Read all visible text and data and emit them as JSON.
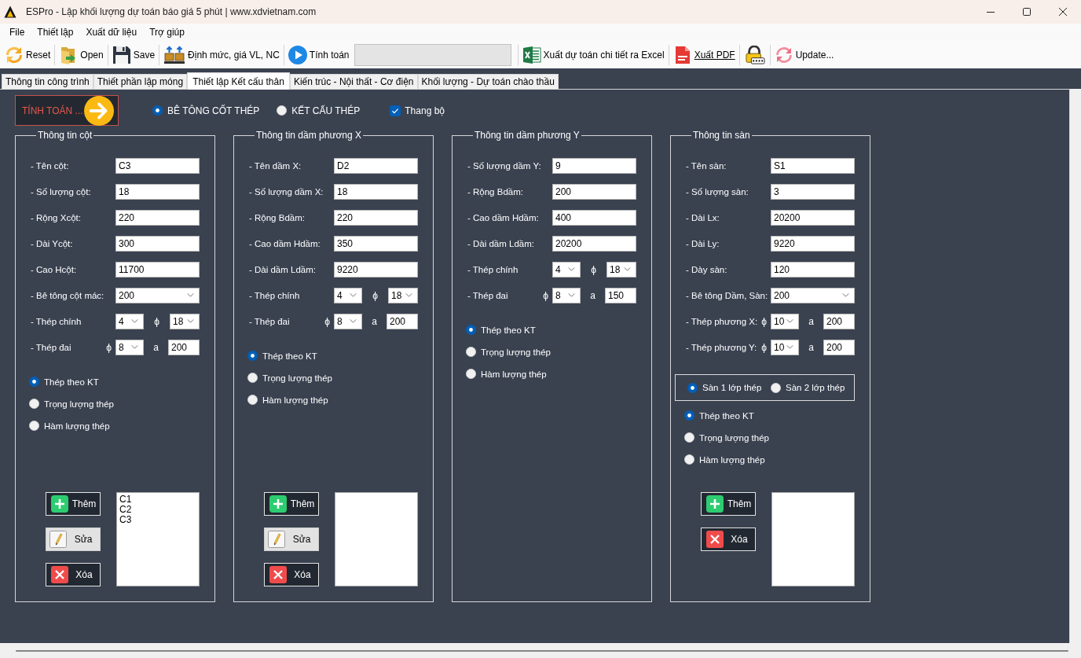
{
  "window": {
    "title": "ESPro - Lập khối lượng dự toán báo giá 5 phút | www.xdvietnam.com"
  },
  "menu": [
    "File",
    "Thiết lập",
    "Xuất dữ liệu",
    "Trợ giúp"
  ],
  "toolbar": [
    {
      "kind": "button",
      "label": "Reset"
    },
    {
      "kind": "button",
      "label": "Open"
    },
    {
      "kind": "button",
      "label": "Save"
    },
    {
      "kind": "button",
      "label": "Định mức, giá VL, NC"
    },
    {
      "kind": "button",
      "label": "Tính toán"
    },
    {
      "kind": "field"
    },
    {
      "kind": "button",
      "label": "Xuất dự toán chi tiết ra Excel"
    },
    {
      "kind": "link",
      "label": "Xuất PDF"
    },
    {
      "kind": "button"
    },
    {
      "kind": "button",
      "label": "Update..."
    }
  ],
  "tabs": [
    {
      "label": "Thông tin công trình",
      "selected": false
    },
    {
      "label": "Thiết phần lập móng",
      "selected": false
    },
    {
      "label": "Thiết lập Kết cấu thân",
      "selected": true
    },
    {
      "label": "Kiến trúc - Nội thất - Cơ điện",
      "selected": false
    },
    {
      "label": "Khối lượng - Dự toán chào thầu",
      "selected": false
    }
  ],
  "calc_button": {
    "label": "TÍNH TOÁN ..."
  },
  "structure_types": [
    {
      "label": "BÊ TÔNG CỐT THÉP",
      "selected": true
    },
    {
      "label": "KẾT CẤU THÉP",
      "selected": false
    }
  ],
  "stairs": {
    "label": "Thang bộ",
    "checked": true
  },
  "groups": [
    {
      "title": "Thông tin cột",
      "rows": [
        {
          "kind": "text",
          "label": "- Tên cột:",
          "value": "C3"
        },
        {
          "kind": "text",
          "label": "- Số lượng cột:",
          "value": "18"
        },
        {
          "kind": "text",
          "label": "- Rộng Xcột:",
          "value": "220"
        },
        {
          "kind": "text",
          "label": "- Dài Ycột:",
          "value": "300"
        },
        {
          "kind": "text",
          "label": "- Cao Hcột:",
          "value": "11700"
        },
        {
          "kind": "select",
          "label": "- Bê tông cột mác:",
          "value": "200"
        },
        {
          "kind": "bars",
          "label": "- Thép chính",
          "count": "4",
          "symbol": "ϕ",
          "diameter": "18"
        },
        {
          "kind": "spacing",
          "label": "- Thép đai",
          "symbol": "ϕ",
          "diameter": "8",
          "spacing_label": "a",
          "spacing": "200"
        }
      ],
      "steel_modes": [
        {
          "label": "Thép theo KT",
          "selected": true
        },
        {
          "label": "Trọng lượng thép",
          "selected": false
        },
        {
          "label": "Hàm lượng thép",
          "selected": false
        }
      ],
      "buttons": [
        {
          "kind": "add",
          "label": "Thêm"
        },
        {
          "kind": "edit",
          "label": "Sửa"
        },
        {
          "kind": "delete",
          "label": "Xóa"
        }
      ],
      "listbox": true,
      "list_items": [
        "C1",
        "C2",
        "C3"
      ]
    },
    {
      "title": "Thông tin dầm phương X",
      "rows": [
        {
          "kind": "text",
          "label": "- Tên dầm X:",
          "value": "D2"
        },
        {
          "kind": "text",
          "label": "- Số lượng dầm X:",
          "value": "18"
        },
        {
          "kind": "text",
          "label": "- Rộng Bdầm:",
          "value": "220"
        },
        {
          "kind": "text",
          "label": "- Cao dầm Hdầm:",
          "value": "350"
        },
        {
          "kind": "text",
          "label": "- Dài dầm Ldầm:",
          "value": "9220"
        },
        {
          "kind": "bars",
          "label": "- Thép chính",
          "count": "4",
          "symbol": "ϕ",
          "diameter": "18"
        },
        {
          "kind": "spacing",
          "label": "- Thép đai",
          "symbol": "ϕ",
          "diameter": "8",
          "spacing_label": "a",
          "spacing": "200"
        }
      ],
      "steel_modes": [
        {
          "label": "Thép theo KT",
          "selected": true
        },
        {
          "label": "Trọng lượng thép",
          "selected": false
        },
        {
          "label": "Hàm lượng thép",
          "selected": false
        }
      ],
      "buttons": [
        {
          "kind": "add",
          "label": "Thêm"
        },
        {
          "kind": "edit",
          "label": "Sửa"
        },
        {
          "kind": "delete",
          "label": "Xóa"
        }
      ],
      "listbox": true
    },
    {
      "title": "Thông tin dầm phương Y",
      "rows": [
        {
          "kind": "text",
          "label": "- Số lượng dầm Y:",
          "value": "9"
        },
        {
          "kind": "text",
          "label": "- Rộng Bdầm:",
          "value": "200"
        },
        {
          "kind": "text",
          "label": "- Cao dầm Hdầm:",
          "value": "400"
        },
        {
          "kind": "text",
          "label": "- Dài dầm Ldầm:",
          "value": "20200"
        },
        {
          "kind": "bars",
          "label": "- Thép chính",
          "count": "4",
          "symbol": "ϕ",
          "diameter": "18"
        },
        {
          "kind": "spacing",
          "label": "- Thép đai",
          "symbol": "ϕ",
          "diameter": "8",
          "spacing_label": "a",
          "spacing": "150"
        }
      ],
      "steel_modes": [
        {
          "label": "Thép theo KT",
          "selected": true
        },
        {
          "label": "Trọng lượng thép",
          "selected": false
        },
        {
          "label": "Hàm lượng thép",
          "selected": false
        }
      ]
    },
    {
      "title": "Thông tin sàn",
      "rows": [
        {
          "kind": "text",
          "label": "- Tên sàn:",
          "value": "S1"
        },
        {
          "kind": "text",
          "label": "- Số lượng sàn:",
          "value": "3"
        },
        {
          "kind": "text",
          "label": "- Dài Lx:",
          "value": "20200"
        },
        {
          "kind": "text",
          "label": "- Dài Ly:",
          "value": "9220"
        },
        {
          "kind": "text",
          "label": "- Dày sàn:",
          "value": "120"
        },
        {
          "kind": "select",
          "label": "- Bê tông Dầm, Sàn:",
          "value": "200"
        },
        {
          "kind": "spacing",
          "label": "- Thép phương X:",
          "symbol": "ϕ",
          "diameter": "10",
          "spacing_label": "a",
          "spacing": "200"
        },
        {
          "kind": "spacing",
          "label": "- Thép phương Y:",
          "symbol": "ϕ",
          "diameter": "10",
          "spacing_label": "a",
          "spacing": "200"
        }
      ],
      "layers": [
        {
          "label": "Sàn 1 lớp thép",
          "selected": true
        },
        {
          "label": "Sàn 2 lớp thép",
          "selected": false
        }
      ],
      "steel_modes": [
        {
          "label": "Thép theo KT",
          "selected": true
        },
        {
          "label": "Trọng lượng thép",
          "selected": false
        },
        {
          "label": "Hàm lượng thép",
          "selected": false
        }
      ],
      "buttons": [
        {
          "kind": "add",
          "label": "Thêm"
        },
        {
          "kind": "delete",
          "label": "Xóa"
        }
      ],
      "listbox": true
    }
  ]
}
